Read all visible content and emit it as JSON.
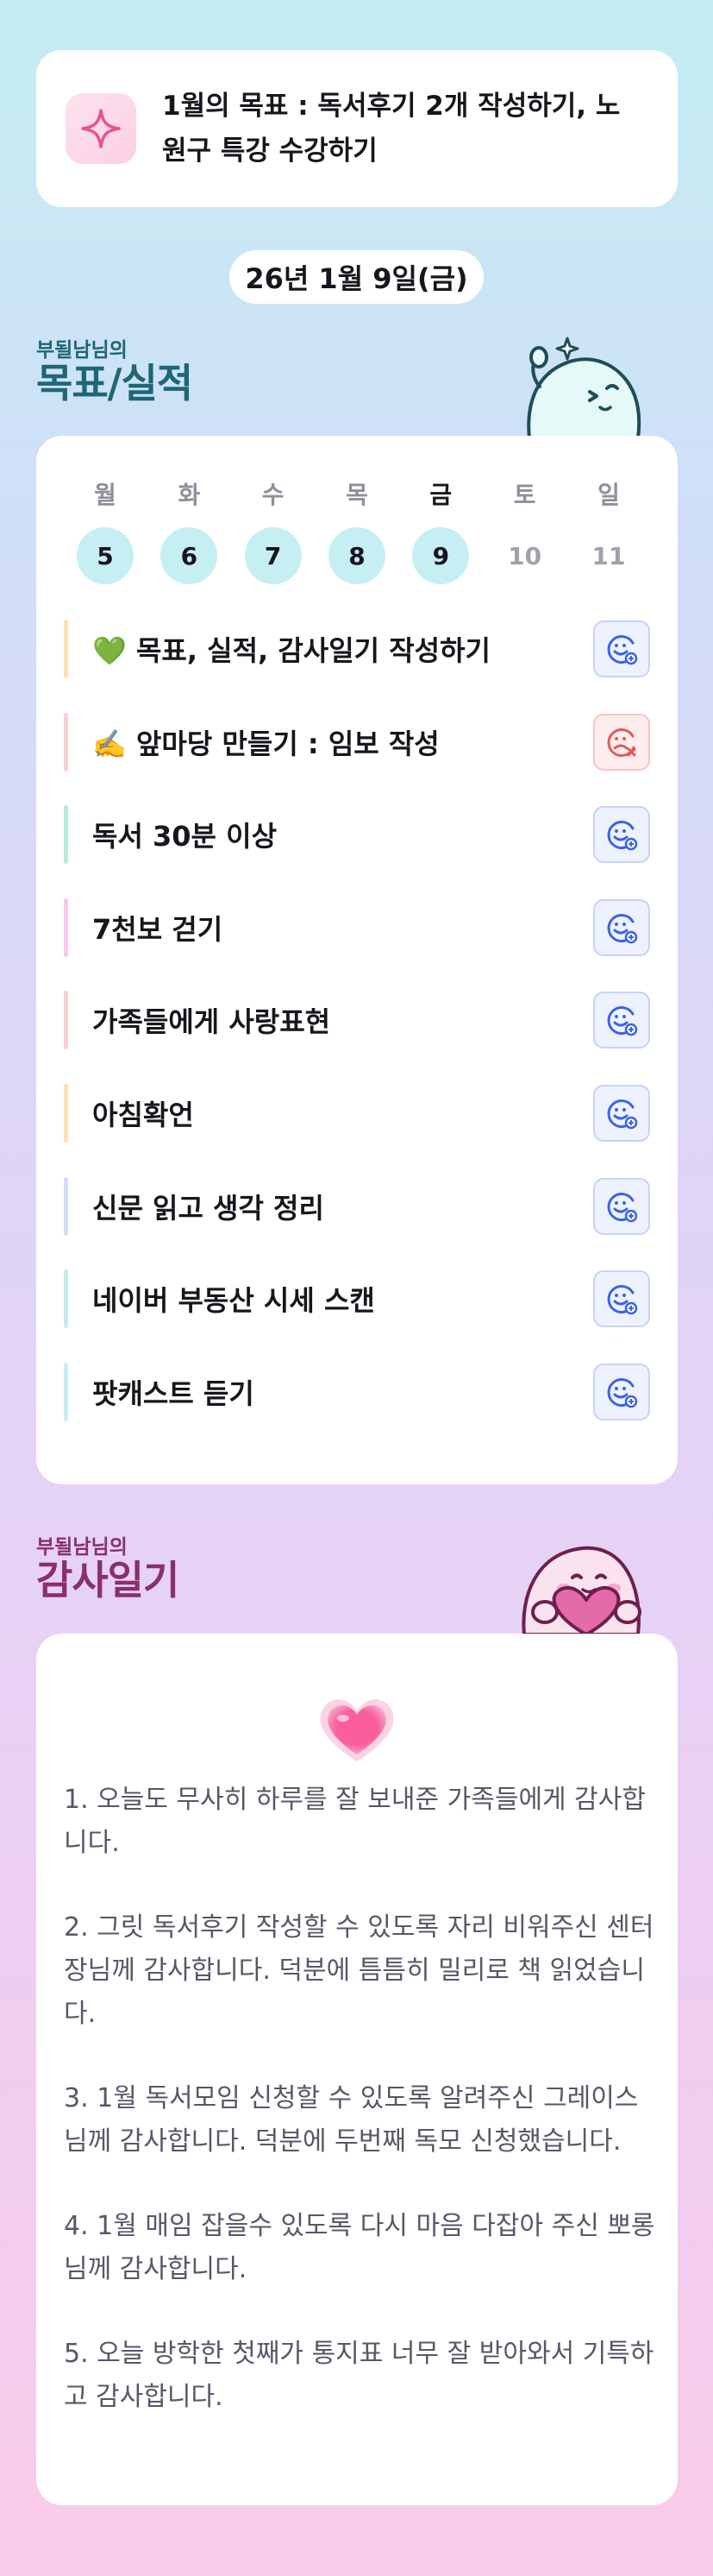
{
  "goal": {
    "icon": "sparkle-icon",
    "text": "1월의 목표 : 독서후기 2개 작성하기, 노원구 특강 수강하기"
  },
  "date": "26년 1월 9일(금)",
  "goal_section": {
    "subtitle": "부될남님의",
    "title": "목표/실적"
  },
  "week": [
    {
      "name": "월",
      "num": "5",
      "state": "done"
    },
    {
      "name": "화",
      "num": "6",
      "state": "done"
    },
    {
      "name": "수",
      "num": "7",
      "state": "done"
    },
    {
      "name": "목",
      "num": "8",
      "state": "done"
    },
    {
      "name": "금",
      "num": "9",
      "state": "today"
    },
    {
      "name": "토",
      "num": "10",
      "state": "future"
    },
    {
      "name": "일",
      "num": "11",
      "state": "future"
    }
  ],
  "habits": [
    {
      "label": "💚  목표, 실적, 감사일기 작성하기",
      "status": "done",
      "bar_color": "#fde0b4"
    },
    {
      "label": "✍️  앞마당 만들기 : 임보 작성",
      "status": "missed",
      "bar_color": "#fbd0d2"
    },
    {
      "label": "독서 30분 이상",
      "status": "done",
      "bar_color": "#b8ecd6"
    },
    {
      "label": "7천보 걷기",
      "status": "done",
      "bar_color": "#f7c8ea"
    },
    {
      "label": "가족들에게 사랑표현",
      "status": "done",
      "bar_color": "#fbcdcd"
    },
    {
      "label": "아침확언",
      "status": "done",
      "bar_color": "#fde0b4"
    },
    {
      "label": "신문 읽고 생각 정리",
      "status": "done",
      "bar_color": "#d3def6"
    },
    {
      "label": "네이버 부동산 시세 스캔",
      "status": "done",
      "bar_color": "#c4eceb"
    },
    {
      "label": "팟캐스트 듣기",
      "status": "done",
      "bar_color": "#c8eef0"
    }
  ],
  "thanks_section": {
    "subtitle": "부될남님의",
    "title": "감사일기"
  },
  "thanks": [
    "1. 오늘도 무사히 하루를 잘 보내준 가족들에게 감사합니다.",
    "2. 그릿 독서후기 작성할 수 있도록 자리 비워주신 센터장님께 감사합니다. 덕분에 틈틈히 밀리로 책 읽었습니다.",
    "3. 1월 독서모임 신청할 수 있도록 알려주신 그레이스님께 감사합니다. 덕분에 두번째 독모 신청했습니다.",
    "4. 1월 매임 잡을수 있도록 다시 마음 다잡아 주신 뽀롱님께 감사합니다.",
    "5. 오늘 방학한 첫째가 통지표 너무 잘 받아와서 기특하고 감사합니다."
  ],
  "colors": {
    "accent_teal": "#1f6676",
    "accent_plum": "#8a2f6e",
    "day_done": "#c6eff3",
    "status_ok": "#3b63e6",
    "status_fail": "#e25a5a"
  }
}
